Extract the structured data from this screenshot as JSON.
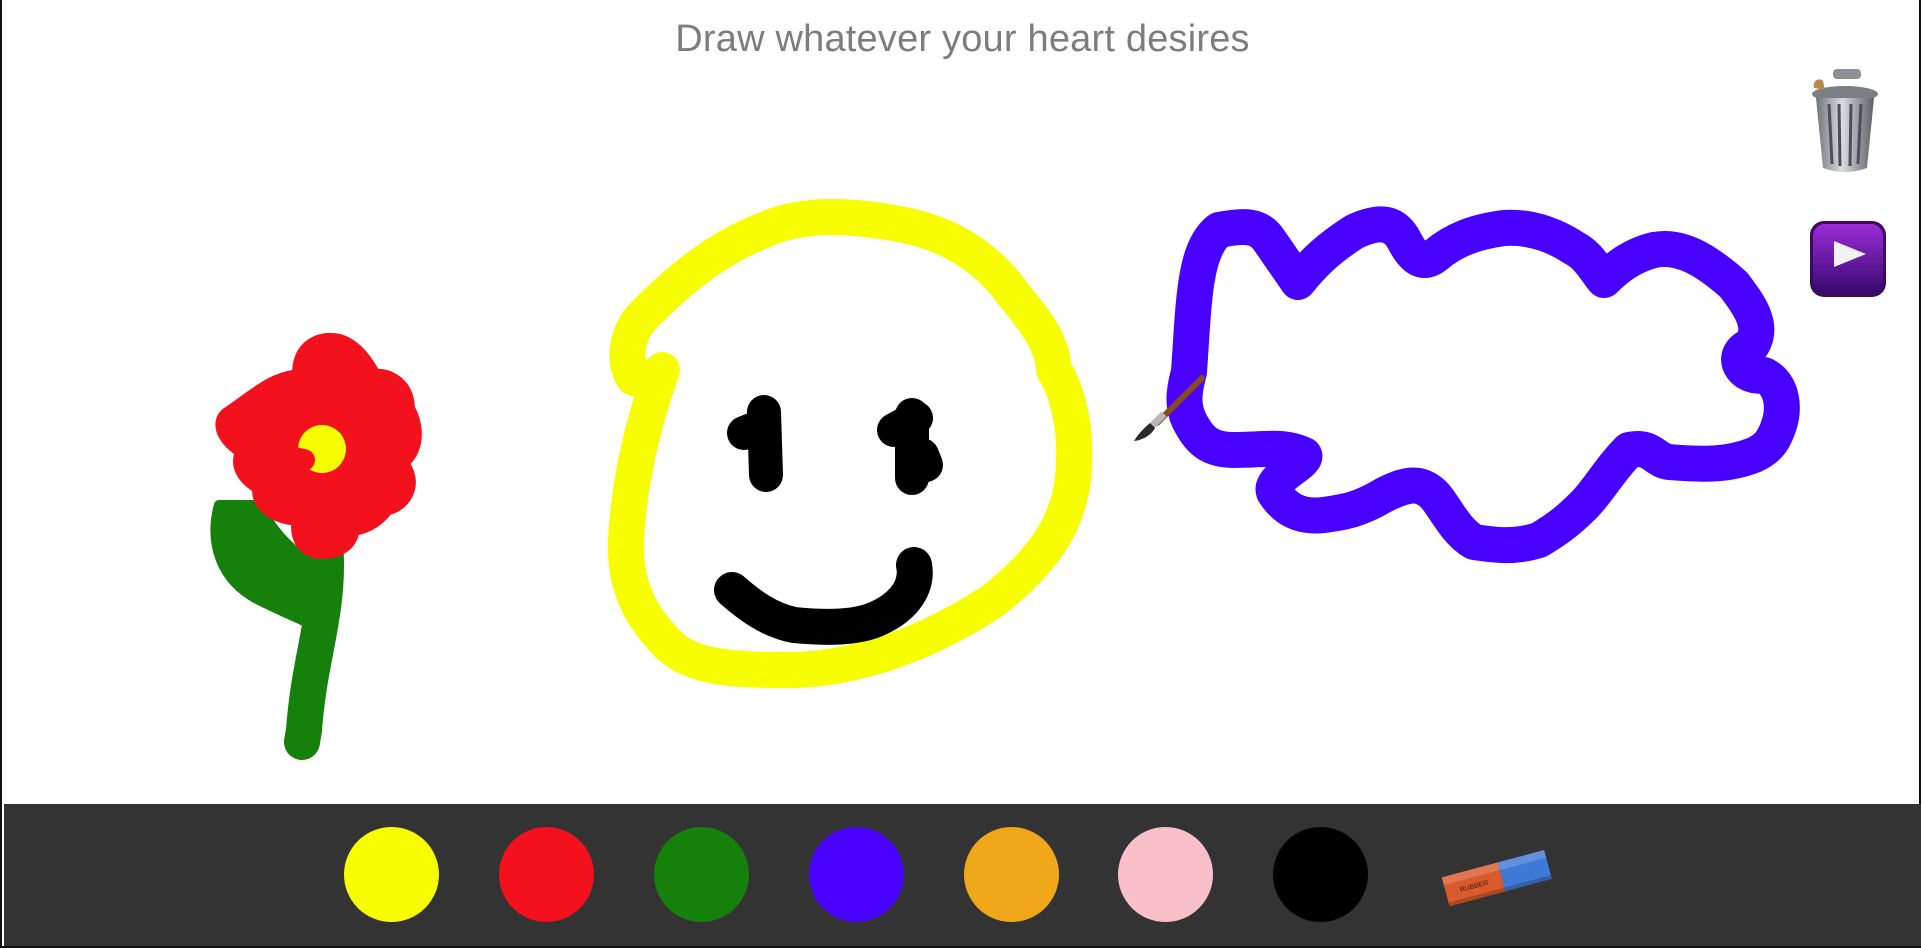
{
  "header": {
    "title": "Draw whatever your heart desires"
  },
  "side_tools": {
    "clear": {
      "icon": "trash-can-icon"
    },
    "play": {
      "icon": "play-icon"
    }
  },
  "palette": {
    "colors": [
      {
        "name": "yellow",
        "hex": "#f7fe00"
      },
      {
        "name": "red",
        "hex": "#f3111d"
      },
      {
        "name": "green",
        "hex": "#15800a"
      },
      {
        "name": "blue",
        "hex": "#4800ff"
      },
      {
        "name": "orange",
        "hex": "#f0a81a"
      },
      {
        "name": "pink",
        "hex": "#f9c0ca"
      },
      {
        "name": "black",
        "hex": "#000000"
      }
    ],
    "eraser": {
      "icon": "eraser-icon",
      "text": "RUBBER"
    }
  },
  "cursor": {
    "icon": "paintbrush-icon"
  },
  "toolbar_bg": "#333333"
}
